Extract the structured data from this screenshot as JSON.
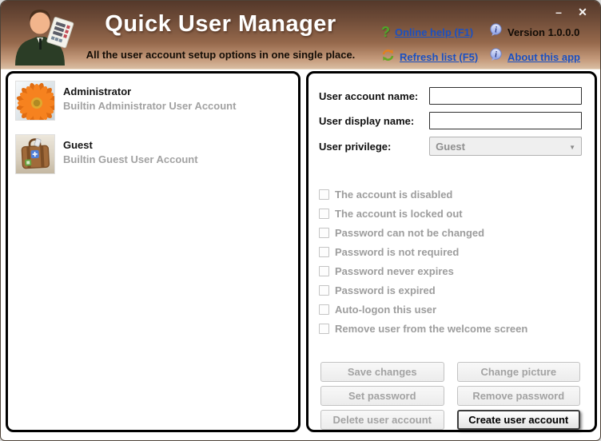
{
  "window": {
    "title": "Quick User Manager",
    "subtitle": "All the user account setup options in one single place.",
    "minimize_glyph": "–",
    "close_glyph": "✕"
  },
  "header_links": {
    "online_help": "Online help (F1)",
    "refresh_list": "Refresh list (F5)",
    "version": "Version 1.0.0.0",
    "about": "About this app"
  },
  "user_list": [
    {
      "name": "Administrator",
      "description": "Builtin Administrator User Account",
      "avatar": "flower-photo"
    },
    {
      "name": "Guest",
      "description": "Builtin Guest User Account",
      "avatar": "suitcase-photo"
    }
  ],
  "form": {
    "fields": {
      "account_name": {
        "label": "User account name:",
        "value": ""
      },
      "display_name": {
        "label": "User display name:",
        "value": ""
      },
      "privilege": {
        "label": "User privilege:",
        "value": "Guest",
        "disabled": true
      }
    },
    "checkboxes": [
      {
        "label": "The account is disabled",
        "checked": false
      },
      {
        "label": "The account is locked out",
        "checked": false
      },
      {
        "label": "Password can not be changed",
        "checked": false
      },
      {
        "label": "Password is not required",
        "checked": false
      },
      {
        "label": "Password never expires",
        "checked": false
      },
      {
        "label": "Password is expired",
        "checked": false
      },
      {
        "label": "Auto-logon this user",
        "checked": false
      },
      {
        "label": "Remove user from the welcome screen",
        "checked": false
      }
    ],
    "buttons": [
      {
        "label": "Save changes",
        "enabled": false
      },
      {
        "label": "Change picture",
        "enabled": false
      },
      {
        "label": "Set password",
        "enabled": false
      },
      {
        "label": "Remove password",
        "enabled": false
      },
      {
        "label": "Delete user account",
        "enabled": false
      },
      {
        "label": "Create user account",
        "enabled": true
      }
    ]
  },
  "colors": {
    "link_blue": "#1a50c2",
    "header_gradient_top": "#54382a",
    "header_gradient_bottom": "#d9bda2",
    "panel_border": "#000000",
    "disabled_text": "#9d9d9d",
    "help_icon_green": "#4fa62a",
    "info_icon_blue": "#8fa3e8"
  }
}
